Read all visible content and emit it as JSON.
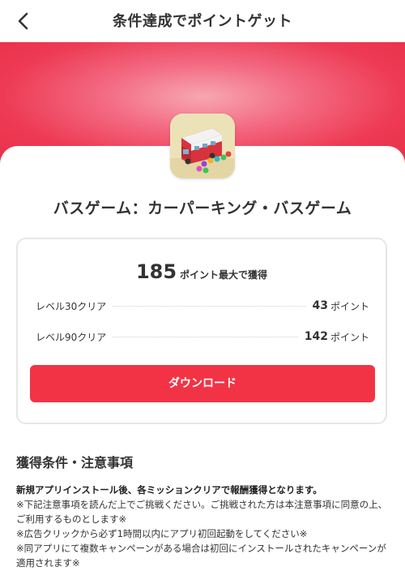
{
  "header": {
    "title": "条件達成でポイントゲット",
    "back_icon": "chevron-left-icon"
  },
  "colors": {
    "accent": "#f23346",
    "hero_center": "#f7a7b3",
    "hero_edge": "#ea2f49"
  },
  "app": {
    "icon": "bus-game-app-icon",
    "name": "バスゲーム：カーパーキング・バスゲーム"
  },
  "reward": {
    "total_points": "185",
    "total_label": "ポイント最大で獲得",
    "missions": [
      {
        "label": "レベル30クリア",
        "points": "43",
        "unit": "ポイント"
      },
      {
        "label": "レベル90クリア",
        "points": "142",
        "unit": "ポイント"
      }
    ],
    "download_label": "ダウンロード"
  },
  "conditions": {
    "title": "獲得条件・注意事項",
    "lead": "新規アプリインストール後、各ミッションクリアで報酬獲得となります。",
    "notes": [
      "※下記注意事項を読んだ上でご挑戦ください。ご挑戦された方は本注意事項に同意の上、ご利用するものとします※",
      "※広告クリックから必ず1時間以内にアプリ初回起動をしてください※",
      "※同アプリにて複数キャンペーンがある場合は初回にインストールされたキャンペーンが適用されます※"
    ]
  }
}
